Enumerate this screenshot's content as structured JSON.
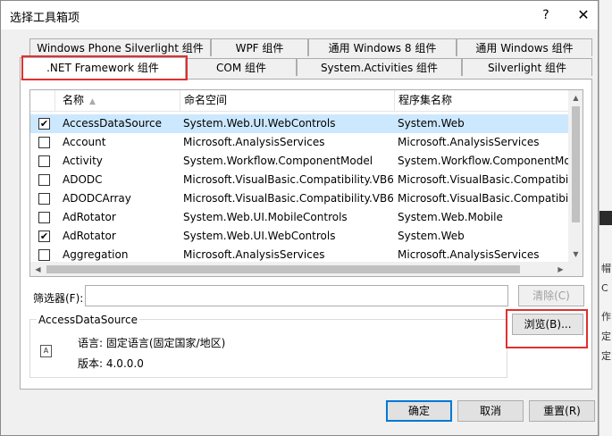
{
  "window": {
    "title": "选择工具箱项",
    "help": "?",
    "close": "✕"
  },
  "tabs_row1": [
    "Windows Phone Silverlight 组件",
    "WPF 组件",
    "通用 Windows 8 组件",
    "通用 Windows 组件"
  ],
  "tabs_row2": [
    ".NET Framework 组件",
    "COM 组件",
    "System.Activities 组件",
    "Silverlight 组件"
  ],
  "list": {
    "columns": [
      "名称",
      "命名空间",
      "程序集名称"
    ],
    "rows": [
      {
        "checked": true,
        "name": "AccessDataSource",
        "namespace": "System.Web.UI.WebControls",
        "assembly": "System.Web",
        "selected": true
      },
      {
        "checked": false,
        "name": "Account",
        "namespace": "Microsoft.AnalysisServices",
        "assembly": "Microsoft.AnalysisServices",
        "selected": false
      },
      {
        "checked": false,
        "name": "Activity",
        "namespace": "System.Workflow.ComponentModel",
        "assembly": "System.Workflow.ComponentMo",
        "selected": false
      },
      {
        "checked": false,
        "name": "ADODC",
        "namespace": "Microsoft.VisualBasic.Compatibility.VB6",
        "assembly": "Microsoft.VisualBasic.Compatibili",
        "selected": false
      },
      {
        "checked": false,
        "name": "ADODCArray",
        "namespace": "Microsoft.VisualBasic.Compatibility.VB6",
        "assembly": "Microsoft.VisualBasic.Compatibili",
        "selected": false
      },
      {
        "checked": false,
        "name": "AdRotator",
        "namespace": "System.Web.UI.MobileControls",
        "assembly": "System.Web.Mobile",
        "selected": false
      },
      {
        "checked": true,
        "name": "AdRotator",
        "namespace": "System.Web.UI.WebControls",
        "assembly": "System.Web",
        "selected": false
      },
      {
        "checked": false,
        "name": "Aggregation",
        "namespace": "Microsoft.AnalysisServices",
        "assembly": "Microsoft.AnalysisServices",
        "selected": false
      }
    ]
  },
  "filter": {
    "label": "筛选器(F):",
    "value": "",
    "clear_label": "清除(C)"
  },
  "details": {
    "title": "AccessDataSource",
    "language": "语言: 固定语言(固定国家/地区)",
    "version": "版本: 4.0.0.0",
    "icon_text": "A"
  },
  "buttons": {
    "browse": "浏览(B)...",
    "ok": "确定",
    "cancel": "取消",
    "reset": "重置(R)"
  },
  "side_text": [
    "帽",
    "C",
    "作",
    "定",
    "定"
  ]
}
